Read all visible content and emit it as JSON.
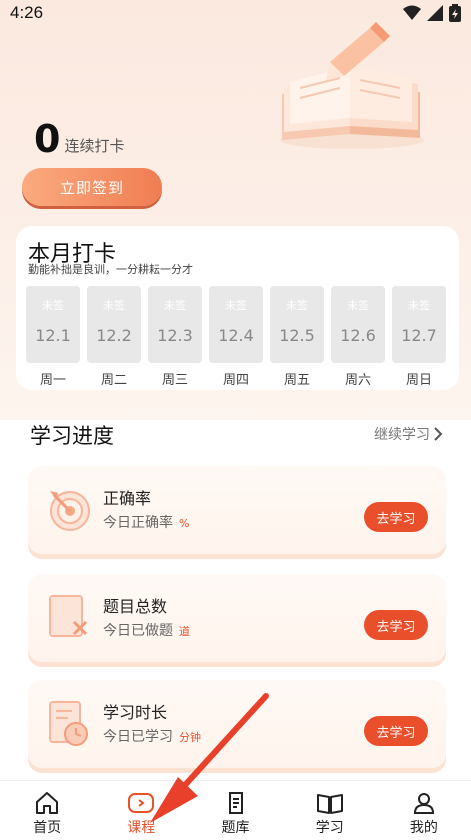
{
  "status_bar": {
    "time": "4:26"
  },
  "checkin": {
    "count": "0",
    "label": "连续打卡",
    "button": "立即签到"
  },
  "month": {
    "title": "本月打卡",
    "subtitle": "勤能补拙是良训，一分耕耘一分才",
    "days": [
      {
        "status": "未签",
        "date": "12.1",
        "weekday": "周一"
      },
      {
        "status": "未签",
        "date": "12.2",
        "weekday": "周二"
      },
      {
        "status": "未签",
        "date": "12.3",
        "weekday": "周三"
      },
      {
        "status": "未签",
        "date": "12.4",
        "weekday": "周四"
      },
      {
        "status": "未签",
        "date": "12.5",
        "weekday": "周五"
      },
      {
        "status": "未签",
        "date": "12.6",
        "weekday": "周六"
      },
      {
        "status": "未签",
        "date": "12.7",
        "weekday": "周日"
      }
    ]
  },
  "progress": {
    "title": "学习进度",
    "continue": "继续学习",
    "cards": [
      {
        "title": "正确率",
        "sub": "今日正确率",
        "unit": "%",
        "button": "去学习",
        "icon": "target-icon"
      },
      {
        "title": "题目总数",
        "sub": "今日已做题",
        "unit": "道",
        "button": "去学习",
        "icon": "question-sheet-icon"
      },
      {
        "title": "学习时长",
        "sub": "今日已学习",
        "unit": "分钟",
        "button": "去学习",
        "icon": "clock-doc-icon"
      }
    ]
  },
  "tabs": [
    {
      "label": "首页",
      "icon": "home-icon",
      "active": false
    },
    {
      "label": "课程",
      "icon": "play-icon",
      "active": true
    },
    {
      "label": "题库",
      "icon": "document-icon",
      "active": false
    },
    {
      "label": "学习",
      "icon": "book-icon",
      "active": false
    },
    {
      "label": "我的",
      "icon": "user-icon",
      "active": false
    }
  ],
  "colors": {
    "accent": "#ea4f2c",
    "button_gradient_start": "#fbaa80",
    "button_gradient_end": "#f07d52"
  }
}
